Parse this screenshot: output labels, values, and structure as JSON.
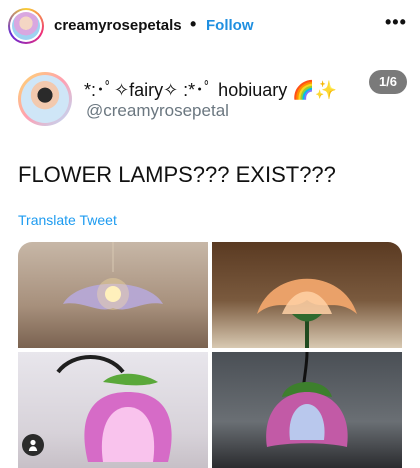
{
  "instagram": {
    "username": "creamyrosepetals",
    "separator": "•",
    "follow_label": "Follow",
    "more_label": "•••"
  },
  "tweet": {
    "display_name": "*:･ﾟ✧fairy✧ :*･ﾟ hobiuary 🌈✨",
    "handle": "@creamyrosepetal",
    "badge": "1/6",
    "text": "FLOWER LAMPS??? EXIST???",
    "translate_label": "Translate Tweet"
  },
  "icons": {
    "tagged_user": "user-icon"
  }
}
